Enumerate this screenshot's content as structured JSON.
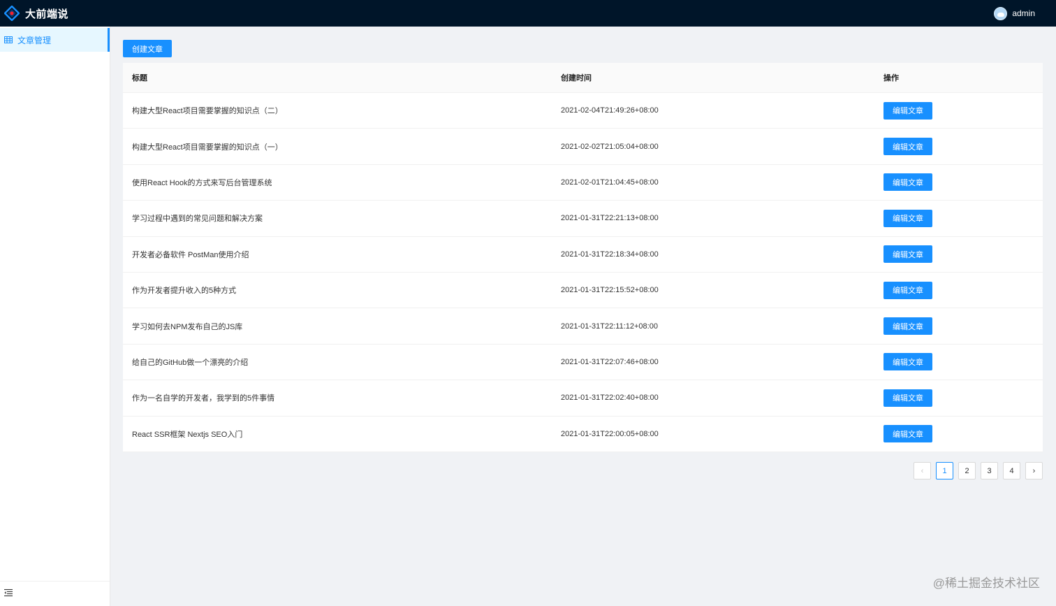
{
  "header": {
    "title": "大前端说",
    "username": "admin"
  },
  "sidebar": {
    "items": [
      {
        "label": "文章管理",
        "icon": "table-icon"
      }
    ]
  },
  "toolbar": {
    "create_label": "创建文章"
  },
  "table": {
    "columns": [
      "标题",
      "创建时间",
      "操作"
    ],
    "rows": [
      {
        "title": "构建大型React项目需要掌握的知识点（二）",
        "created": "2021-02-04T21:49:26+08:00",
        "action": "编辑文章"
      },
      {
        "title": "构建大型React项目需要掌握的知识点（一）",
        "created": "2021-02-02T21:05:04+08:00",
        "action": "编辑文章"
      },
      {
        "title": "使用React Hook的方式来写后台管理系统",
        "created": "2021-02-01T21:04:45+08:00",
        "action": "编辑文章"
      },
      {
        "title": "学习过程中遇到的常见问题和解决方案",
        "created": "2021-01-31T22:21:13+08:00",
        "action": "编辑文章"
      },
      {
        "title": "开发者必备软件 PostMan使用介绍",
        "created": "2021-01-31T22:18:34+08:00",
        "action": "编辑文章"
      },
      {
        "title": "作为开发者提升收入的5种方式",
        "created": "2021-01-31T22:15:52+08:00",
        "action": "编辑文章"
      },
      {
        "title": "学习如何去NPM发布自己的JS库",
        "created": "2021-01-31T22:11:12+08:00",
        "action": "编辑文章"
      },
      {
        "title": "给自己的GitHub做一个漂亮的介绍",
        "created": "2021-01-31T22:07:46+08:00",
        "action": "编辑文章"
      },
      {
        "title": "作为一名自学的开发者，我学到的5件事情",
        "created": "2021-01-31T22:02:40+08:00",
        "action": "编辑文章"
      },
      {
        "title": "React SSR框架 Nextjs SEO入门",
        "created": "2021-01-31T22:00:05+08:00",
        "action": "编辑文章"
      }
    ]
  },
  "pagination": {
    "prev": "‹",
    "next": "›",
    "pages": [
      "1",
      "2",
      "3",
      "4"
    ],
    "current": "1"
  },
  "watermark": "@稀土掘金技术社区",
  "colors": {
    "header_bg": "#001529",
    "primary": "#1890ff",
    "page_bg": "#f0f2f5"
  }
}
